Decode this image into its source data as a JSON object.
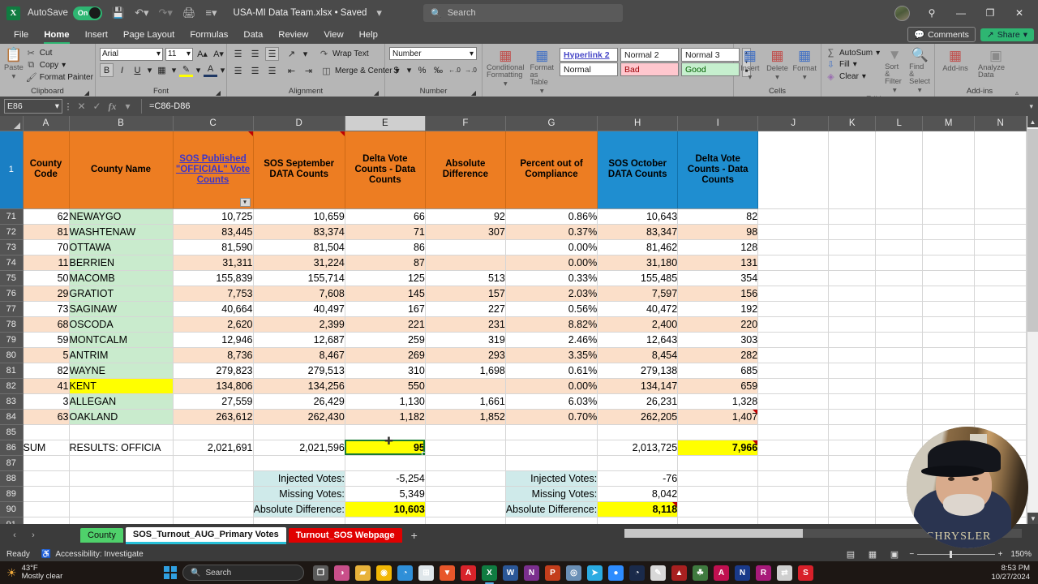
{
  "titlebar": {
    "app_icon": "excel-icon",
    "autosave_label": "AutoSave",
    "autosave_state": "On",
    "document_title": "USA-MI Data Team.xlsx  •  Saved",
    "search_placeholder": "Search",
    "minimize": "—",
    "restore": "❐",
    "close": "✕"
  },
  "ribbon_tabs": {
    "items": [
      "File",
      "Home",
      "Insert",
      "Page Layout",
      "Formulas",
      "Data",
      "Review",
      "View",
      "Help"
    ],
    "active": "Home",
    "comments_label": "Comments",
    "share_label": "Share"
  },
  "ribbon": {
    "clipboard": {
      "title": "Clipboard",
      "paste": "Paste",
      "cut": "Cut",
      "copy": "Copy",
      "format_painter": "Format Painter"
    },
    "font": {
      "title": "Font",
      "font_name": "Arial",
      "font_size": "11",
      "grow": "A",
      "shrink": "A",
      "bold": "B",
      "italic": "I",
      "underline": "U",
      "borders": "⊞",
      "fill_color": "◆",
      "font_color": "A"
    },
    "alignment": {
      "title": "Alignment",
      "wrap_text": "Wrap Text",
      "merge_center": "Merge & Center"
    },
    "number": {
      "title": "Number",
      "format": "Number",
      "currency": "$",
      "percent": "%",
      "comma": "‰",
      "inc_decimal": "←.00",
      "dec_decimal": "→.0"
    },
    "styles": {
      "title": "Styles",
      "conditional_formatting": "Conditional Formatting",
      "format_as_table": "Format as Table",
      "cells": [
        "Hyperlink 2",
        "Normal 2",
        "Normal 3",
        "Normal",
        "Bad",
        "Good"
      ]
    },
    "cells": {
      "title": "Cells",
      "insert": "Insert",
      "delete": "Delete",
      "format": "Format"
    },
    "editing": {
      "title": "Editing",
      "autosum": "AutoSum",
      "fill": "Fill",
      "clear": "Clear",
      "sort_filter": "Sort & Filter",
      "find_select": "Find & Select"
    },
    "addins": {
      "title": "Add-ins",
      "addins": "Add-ins",
      "analyze_data": "Analyze Data"
    }
  },
  "formula_bar": {
    "name_box": "E86",
    "cancel": "✕",
    "enter": "✓",
    "fx": "fx",
    "formula": "=C86-D86"
  },
  "grid": {
    "column_letters": [
      "A",
      "B",
      "C",
      "D",
      "E",
      "F",
      "G",
      "H",
      "I",
      "J",
      "K",
      "L",
      "M",
      "N"
    ],
    "selected_column": "E",
    "headers": [
      {
        "id": "A",
        "text": "County Code",
        "color": "#ed7d22",
        "filter": true
      },
      {
        "id": "B",
        "text": "County Name",
        "color": "#ed7d22",
        "filter": true
      },
      {
        "id": "C",
        "text": "SOS Published \"OFFICIAL\" Vote Counts",
        "color": "#ed7d22",
        "filter": true,
        "link": true,
        "note": true
      },
      {
        "id": "D",
        "text": "SOS September DATA Counts",
        "color": "#ed7d22",
        "filter": true,
        "note": true
      },
      {
        "id": "E",
        "text": "Delta Vote Counts - Data Counts",
        "color": "#ed7d22",
        "filter": true
      },
      {
        "id": "F",
        "text": "Absolute Difference",
        "color": "#ed7d22",
        "filter": true
      },
      {
        "id": "G",
        "text": "Percent out of Compliance",
        "color": "#ed7d22",
        "filter": true
      },
      {
        "id": "H",
        "text": "SOS October DATA Counts",
        "color": "#1f8ed0",
        "filter": true
      },
      {
        "id": "I",
        "text": "Delta Vote Counts - Data Counts",
        "color": "#1f8ed0",
        "filter": true
      }
    ],
    "rows": [
      {
        "n": "71",
        "band": "A",
        "code": "62",
        "name": "NEWAYGO",
        "official": "10,725",
        "sept": "10,659",
        "delta": "66",
        "absdiff": "92",
        "pct": "0.86%",
        "oct": "10,643",
        "delta2": "82"
      },
      {
        "n": "72",
        "band": "B",
        "code": "81",
        "name": "WASHTENAW",
        "official": "83,445",
        "sept": "83,374",
        "delta": "71",
        "absdiff": "307",
        "pct": "0.37%",
        "oct": "83,347",
        "delta2": "98"
      },
      {
        "n": "73",
        "band": "A",
        "code": "70",
        "name": "OTTAWA",
        "official": "81,590",
        "sept": "81,504",
        "delta": "86",
        "absdiff": "",
        "pct": "0.00%",
        "oct": "81,462",
        "delta2": "128"
      },
      {
        "n": "74",
        "band": "B",
        "code": "11",
        "name": "BERRIEN",
        "official": "31,311",
        "sept": "31,224",
        "delta": "87",
        "absdiff": "",
        "pct": "0.00%",
        "oct": "31,180",
        "delta2": "131"
      },
      {
        "n": "75",
        "band": "A",
        "code": "50",
        "name": "MACOMB",
        "official": "155,839",
        "sept": "155,714",
        "delta": "125",
        "absdiff": "513",
        "pct": "0.33%",
        "oct": "155,485",
        "delta2": "354"
      },
      {
        "n": "76",
        "band": "B",
        "code": "29",
        "name": "GRATIOT",
        "official": "7,753",
        "sept": "7,608",
        "delta": "145",
        "absdiff": "157",
        "pct": "2.03%",
        "oct": "7,597",
        "delta2": "156"
      },
      {
        "n": "77",
        "band": "A",
        "code": "73",
        "name": "SAGINAW",
        "official": "40,664",
        "sept": "40,497",
        "delta": "167",
        "absdiff": "227",
        "pct": "0.56%",
        "oct": "40,472",
        "delta2": "192"
      },
      {
        "n": "78",
        "band": "B",
        "code": "68",
        "name": "OSCODA",
        "official": "2,620",
        "sept": "2,399",
        "delta": "221",
        "absdiff": "231",
        "pct": "8.82%",
        "oct": "2,400",
        "delta2": "220"
      },
      {
        "n": "79",
        "band": "A",
        "code": "59",
        "name": "MONTCALM",
        "official": "12,946",
        "sept": "12,687",
        "delta": "259",
        "absdiff": "319",
        "pct": "2.46%",
        "oct": "12,643",
        "delta2": "303"
      },
      {
        "n": "80",
        "band": "B",
        "code": "5",
        "name": "ANTRIM",
        "official": "8,736",
        "sept": "8,467",
        "delta": "269",
        "absdiff": "293",
        "pct": "3.35%",
        "oct": "8,454",
        "delta2": "282"
      },
      {
        "n": "81",
        "band": "A",
        "code": "82",
        "name": "WAYNE",
        "official": "279,823",
        "sept": "279,513",
        "delta": "310",
        "absdiff": "1,698",
        "pct": "0.61%",
        "oct": "279,138",
        "delta2": "685"
      },
      {
        "n": "82",
        "band": "B",
        "code": "41",
        "name": "KENT",
        "official": "134,806",
        "sept": "134,256",
        "delta": "550",
        "absdiff": "",
        "pct": "0.00%",
        "oct": "134,147",
        "delta2": "659",
        "name_highlight": "yellow"
      },
      {
        "n": "83",
        "band": "A",
        "code": "3",
        "name": "ALLEGAN",
        "official": "27,559",
        "sept": "26,429",
        "delta": "1,130",
        "absdiff": "1,661",
        "pct": "6.03%",
        "oct": "26,231",
        "delta2": "1,328"
      },
      {
        "n": "84",
        "band": "B",
        "code": "63",
        "name": "OAKLAND",
        "official": "263,612",
        "sept": "262,430",
        "delta": "1,182",
        "absdiff": "1,852",
        "pct": "0.70%",
        "oct": "262,205",
        "delta2": "1,407",
        "note2": true
      }
    ],
    "blank_row_85": "85",
    "sum_row": {
      "n": "86",
      "label": "SUM",
      "name": "RESULTS: OFFICIA",
      "official": "2,021,691",
      "sept": "2,021,596",
      "delta": "95",
      "oct": "2,013,725",
      "delta2": "7,966"
    },
    "blank_row_87": "87",
    "summary_left": [
      {
        "n": "88",
        "label": "Injected Votes:",
        "value": "-5,254"
      },
      {
        "n": "89",
        "label": "Missing Votes:",
        "value": "5,349"
      },
      {
        "n": "90",
        "label": "Absolute Difference:",
        "value": "10,603",
        "highlight": "yellow"
      }
    ],
    "summary_right": [
      {
        "label": "Injected Votes:",
        "value": "-76"
      },
      {
        "label": "Missing Votes:",
        "value": "8,042"
      },
      {
        "label": "Absolute Difference:",
        "value": "8,118",
        "highlight": "yellow"
      }
    ],
    "blank_row_91": "91"
  },
  "sheet_tabs": {
    "prev": "‹",
    "next": "›",
    "items": [
      {
        "label": "County",
        "style": "green"
      },
      {
        "label": "SOS_Turnout_AUG_Primary Votes",
        "style": "active"
      },
      {
        "label": "Turnout_SOS Webpage",
        "style": "red"
      }
    ],
    "add": "+"
  },
  "status_bar": {
    "ready": "Ready",
    "accessibility": "Accessibility: Investigate",
    "zoom": "150%",
    "views": [
      "normal-view",
      "page-layout-view",
      "page-break-view"
    ]
  },
  "taskbar": {
    "weather_temp": "43°F",
    "weather_desc": "Mostly clear",
    "search_placeholder": "Search",
    "clock_time": "8:53 PM",
    "clock_date": "10/27/2024",
    "apps": [
      {
        "name": "task-view",
        "glyph": "❐",
        "color": "#5a5a5a"
      },
      {
        "name": "copilot",
        "glyph": "◑",
        "color": "#c94f8a"
      },
      {
        "name": "file-explorer",
        "glyph": "▰",
        "color": "#e8b23a"
      },
      {
        "name": "chrome",
        "glyph": "◉",
        "color": "#f2b705"
      },
      {
        "name": "edge",
        "glyph": "◔",
        "color": "#2f8fd8"
      },
      {
        "name": "microsoft-store",
        "glyph": "⊞",
        "color": "#dfe6ea"
      },
      {
        "name": "brave",
        "glyph": "▼",
        "color": "#e8562a"
      },
      {
        "name": "acrobat",
        "glyph": "A",
        "color": "#d8232a"
      },
      {
        "name": "excel",
        "glyph": "X",
        "color": "#107c41"
      },
      {
        "name": "word",
        "glyph": "W",
        "color": "#2b5797"
      },
      {
        "name": "onenote",
        "glyph": "N",
        "color": "#7b2f8e"
      },
      {
        "name": "powerpoint",
        "glyph": "P",
        "color": "#c43e1c"
      },
      {
        "name": "postgres",
        "glyph": "◎",
        "color": "#6a8fb5"
      },
      {
        "name": "telegram",
        "glyph": "➤",
        "color": "#2aabe2"
      },
      {
        "name": "zoom",
        "glyph": "●",
        "color": "#2d8cff"
      },
      {
        "name": "speedtest",
        "glyph": "◔",
        "color": "#1a2a4a"
      },
      {
        "name": "notepad",
        "glyph": "✎",
        "color": "#d8d8d8"
      },
      {
        "name": "editor",
        "glyph": "▲",
        "color": "#a82020"
      },
      {
        "name": "tree-app",
        "glyph": "☘",
        "color": "#3f7a3f"
      },
      {
        "name": "affinity",
        "glyph": "A",
        "color": "#c01050"
      },
      {
        "name": "notion",
        "glyph": "N",
        "color": "#1a3a8a"
      },
      {
        "name": "rhino",
        "glyph": "R",
        "color": "#a81a7a"
      },
      {
        "name": "sync",
        "glyph": "⇄",
        "color": "#cfcfcf"
      },
      {
        "name": "snagit",
        "glyph": "S",
        "color": "#d8202a"
      }
    ]
  }
}
